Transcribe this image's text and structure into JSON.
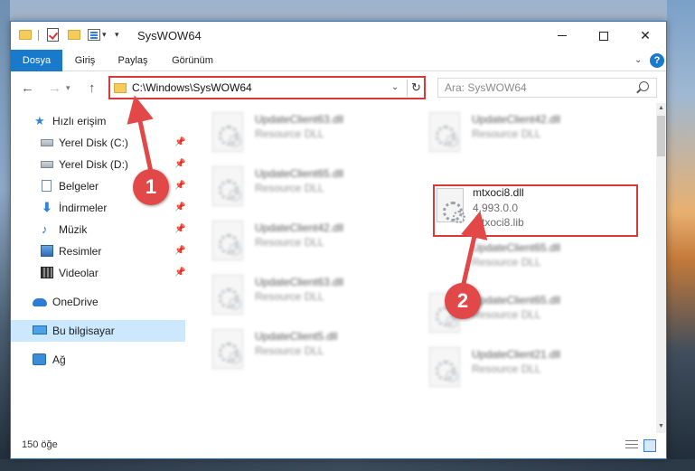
{
  "window": {
    "title": "SysWOW64",
    "controls": {
      "minimize": "minimize",
      "maximize": "maximize",
      "close": "✕"
    }
  },
  "ribbon": {
    "tabs": [
      "Dosya",
      "Giriş",
      "Paylaş",
      "Görünüm"
    ],
    "help": "?"
  },
  "address": {
    "path": "C:\\Windows\\SysWOW64",
    "search_placeholder": "Ara: SysWOW64"
  },
  "sidebar": {
    "items": [
      {
        "label": "Hızlı erişim",
        "icon": "star-icon"
      },
      {
        "label": "Yerel Disk (C:)",
        "icon": "disk-icon",
        "pinned": true
      },
      {
        "label": "Yerel Disk (D:)",
        "icon": "disk-icon",
        "pinned": true
      },
      {
        "label": "Belgeler",
        "icon": "document-icon",
        "pinned": true
      },
      {
        "label": "İndirmeler",
        "icon": "download-icon",
        "pinned": true
      },
      {
        "label": "Müzik",
        "icon": "music-icon",
        "pinned": true
      },
      {
        "label": "Resimler",
        "icon": "pictures-icon",
        "pinned": true
      },
      {
        "label": "Videolar",
        "icon": "videos-icon",
        "pinned": true
      },
      {
        "label": "OneDrive",
        "icon": "onedrive-icon"
      },
      {
        "label": "Bu bilgisayar",
        "icon": "computer-icon",
        "selected": true
      },
      {
        "label": "Ağ",
        "icon": "network-icon"
      }
    ]
  },
  "files": {
    "left_column": [
      {
        "name": "UpdateClient63.dll",
        "type": "Resource DLL"
      },
      {
        "name": "UpdateClient65.dll",
        "type": "Resource DLL"
      },
      {
        "name": "UpdateClient42.dll",
        "type": "Resource DLL"
      },
      {
        "name": "UpdateClient63.dll",
        "type": "Resource DLL"
      },
      {
        "name": "UpdateClient5.dll",
        "type": "Resource DLL"
      }
    ],
    "right_column": [
      {
        "name": "UpdateClient42.dll",
        "type": "Resource DLL"
      },
      {
        "name": "mtxoci8.dll",
        "version": "4.993.0.0",
        "lib": "mtxoci8.lib",
        "highlighted": true
      },
      {
        "name": "UpdateClient65.dll",
        "type": "Resource DLL"
      },
      {
        "name": "UpdateClient65.dll",
        "type": "Resource DLL"
      },
      {
        "name": "UpdateClient21.dll",
        "type": "Resource DLL"
      }
    ]
  },
  "status": {
    "item_count": "150 öğe"
  },
  "annotations": {
    "step1": "1",
    "step2": "2"
  },
  "colors": {
    "accent": "#1979ca",
    "highlight": "#d83a3a",
    "annotation": "#e34848",
    "selected": "#cce8ff"
  }
}
